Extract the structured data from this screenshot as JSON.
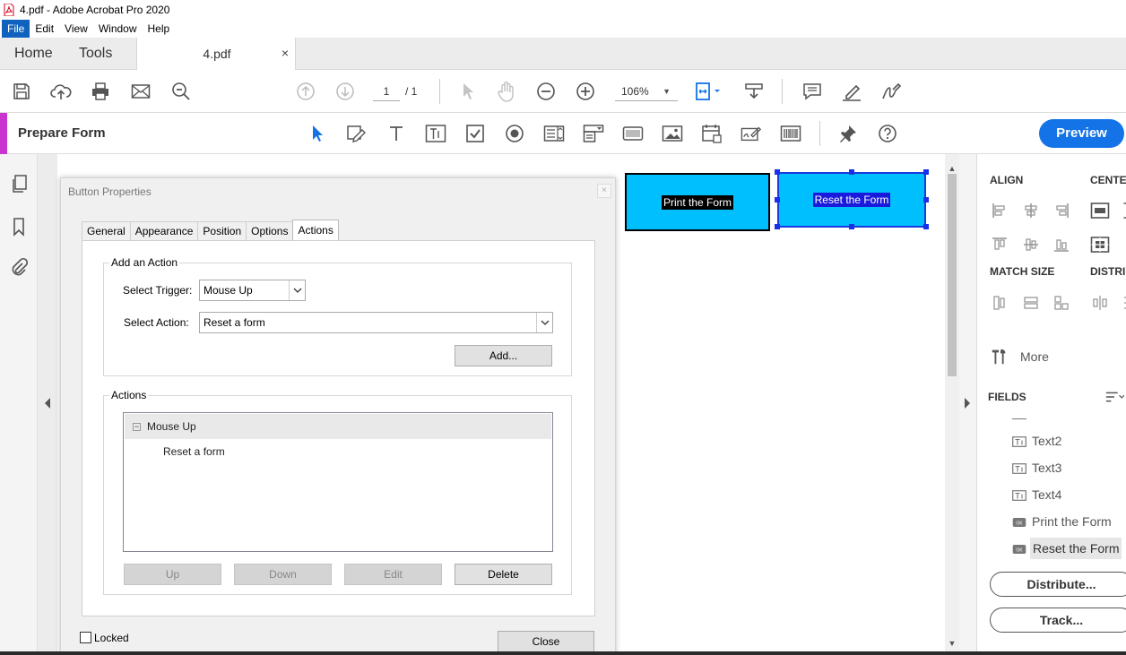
{
  "app": {
    "title": "4.pdf - Adobe Acrobat Pro 2020"
  },
  "menu": [
    "File",
    "Edit",
    "View",
    "Window",
    "Help"
  ],
  "nav": {
    "home": "Home",
    "tools": "Tools",
    "doc_tab": "4.pdf",
    "close": "×"
  },
  "toolbar": {
    "page_current": "1",
    "page_total": "/ 1",
    "zoom": "106%"
  },
  "form_bar": {
    "label": "Prepare Form",
    "preview": "Preview"
  },
  "doc_buttons": {
    "print": "Print the Form",
    "reset": "Reset the Form"
  },
  "dialog": {
    "title": "Button Properties",
    "tabs": [
      "General",
      "Appearance",
      "Position",
      "Options",
      "Actions"
    ],
    "active_tab": "Actions",
    "add_action": {
      "legend": "Add an Action",
      "trigger_label": "Select Trigger:",
      "trigger_value": "Mouse Up",
      "action_label": "Select Action:",
      "action_value": "Reset a form",
      "add_button": "Add..."
    },
    "actions": {
      "legend": "Actions",
      "tree_expander": "⊟",
      "tree_parent": "Mouse Up",
      "tree_child": "Reset a form",
      "buttons": {
        "up": "Up",
        "down": "Down",
        "edit": "Edit",
        "delete": "Delete"
      }
    },
    "locked_label": "Locked",
    "close_button": "Close"
  },
  "right_panel": {
    "align": "ALIGN",
    "center": "CENTER",
    "match_size": "MATCH SIZE",
    "distribute_head": "DISTRI",
    "more": "More",
    "fields": "FIELDS",
    "field_items": [
      "Text2",
      "Text3",
      "Text4",
      "Print the Form",
      "Reset the Form"
    ],
    "selected_field": "Reset the Form",
    "distribute_button": "Distribute...",
    "track_button": "Track..."
  },
  "colors": {
    "accent_blue": "#1473e6",
    "form_accent": "#c835cf",
    "button_fill": "#00bfff"
  }
}
